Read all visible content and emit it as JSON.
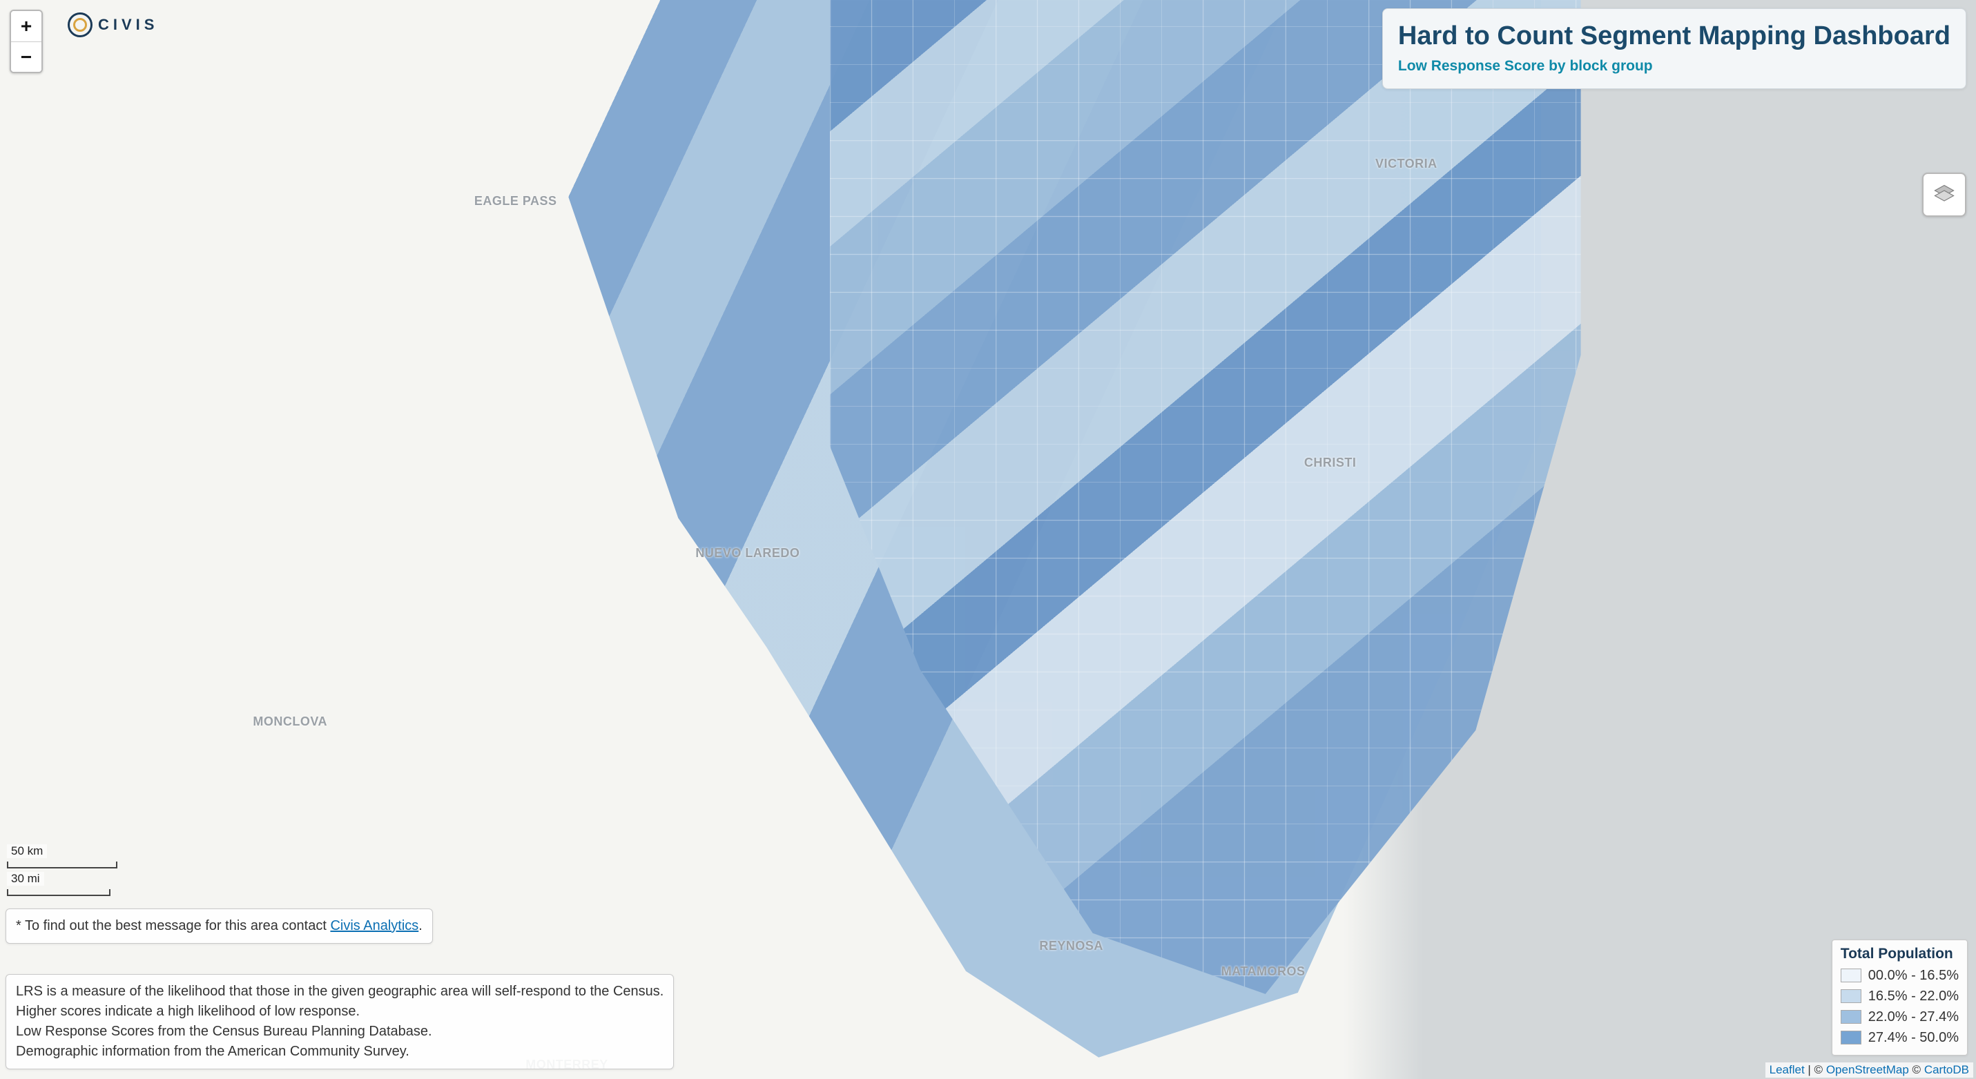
{
  "logo": {
    "text": "CIVIS"
  },
  "zoom": {
    "in": "+",
    "out": "−"
  },
  "title_card": {
    "title": "Hard to Count Segment Mapping Dashboard",
    "subtitle": "Low Response Score by block group"
  },
  "city_labels": [
    {
      "text": "EAGLE PASS",
      "top": "18.0%",
      "left": "24.0%"
    },
    {
      "text": "VICTORIA",
      "top": "14.5%",
      "left": "69.6%"
    },
    {
      "text": "CHRISTI",
      "top": "42.2%",
      "left": "66.0%"
    },
    {
      "text": "NUEVO LAREDO",
      "top": "50.6%",
      "left": "35.2%"
    },
    {
      "text": "MONCLOVA",
      "top": "66.2%",
      "left": "12.8%"
    },
    {
      "text": "REYNOSA",
      "top": "87.0%",
      "left": "52.6%"
    },
    {
      "text": "MATAMOROS",
      "top": "89.4%",
      "left": "61.8%"
    },
    {
      "text": "MONTERREY",
      "top": "98.0%",
      "left": "26.6%"
    }
  ],
  "scale": {
    "km": "50 km",
    "mi": "30 mi"
  },
  "info": {
    "contact_prefix": "* To find out the best message for this area contact ",
    "contact_link": "Civis Analytics",
    "contact_suffix": ".",
    "lrs_line1": "LRS is a measure of the likelihood that those in the given geographic area will self-respond to the Census.",
    "lrs_line2": "Higher scores indicate a high likelihood of low response.",
    "lrs_line3": "Low Response Scores from the Census Bureau Planning Database.",
    "lrs_line4": "Demographic information from the American Community Survey."
  },
  "legend": {
    "title": "Total Population",
    "items": [
      {
        "label": "00.0% - 16.5%",
        "color": "#eef4fa"
      },
      {
        "label": "16.5% - 22.0%",
        "color": "#c7dbed"
      },
      {
        "label": "22.0% - 27.4%",
        "color": "#9fc0e0"
      },
      {
        "label": "27.4% - 50.0%",
        "color": "#76a4d3"
      }
    ]
  },
  "attribution": {
    "leaflet": "Leaflet",
    "sep1": " | © ",
    "osm": "OpenStreetMap",
    "sep2": " © ",
    "carto": "CartoDB"
  }
}
